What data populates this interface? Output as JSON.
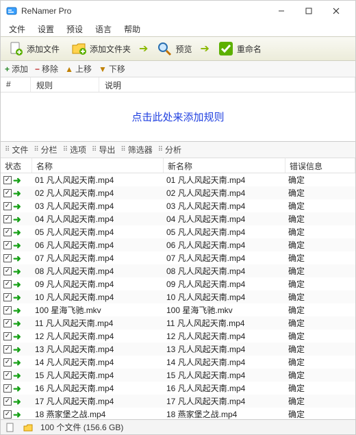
{
  "window": {
    "title": "ReNamer Pro"
  },
  "menu": {
    "file": "文件",
    "settings": "设置",
    "presets": "预设",
    "language": "语言",
    "help": "帮助"
  },
  "toolbar1": {
    "add_files": "添加文件",
    "add_folders": "添加文件夹",
    "preview": "预览",
    "rename": "重命名"
  },
  "toolbar2": {
    "add": "添加",
    "remove": "移除",
    "up": "上移",
    "down": "下移"
  },
  "rules": {
    "col_num": "#",
    "col_rule": "规则",
    "col_desc": "说明",
    "placeholder": "点击此处来添加规则"
  },
  "toolbar3": {
    "files": "文件",
    "columns": "分栏",
    "options": "选项",
    "export": "导出",
    "filter": "筛选器",
    "analyze": "分析"
  },
  "filecols": {
    "state": "状态",
    "name": "名称",
    "newname": "新名称",
    "err": "错误信息"
  },
  "files": [
    {
      "name": "01 凡人风起天南.mp4",
      "newname": "01 凡人风起天南.mp4",
      "err": "确定"
    },
    {
      "name": "02 凡人风起天南.mp4",
      "newname": "02 凡人风起天南.mp4",
      "err": "确定"
    },
    {
      "name": "03 凡人风起天南.mp4",
      "newname": "03 凡人风起天南.mp4",
      "err": "确定"
    },
    {
      "name": "04 凡人风起天南.mp4",
      "newname": "04 凡人风起天南.mp4",
      "err": "确定"
    },
    {
      "name": "05 凡人风起天南.mp4",
      "newname": "05 凡人风起天南.mp4",
      "err": "确定"
    },
    {
      "name": "06 凡人风起天南.mp4",
      "newname": "06 凡人风起天南.mp4",
      "err": "确定"
    },
    {
      "name": "07 凡人风起天南.mp4",
      "newname": "07 凡人风起天南.mp4",
      "err": "确定"
    },
    {
      "name": "08 凡人风起天南.mp4",
      "newname": "08 凡人风起天南.mp4",
      "err": "确定"
    },
    {
      "name": "09 凡人风起天南.mp4",
      "newname": "09 凡人风起天南.mp4",
      "err": "确定"
    },
    {
      "name": "10 凡人风起天南.mp4",
      "newname": "10 凡人风起天南.mp4",
      "err": "确定"
    },
    {
      "name": "100 星海飞驰.mkv",
      "newname": "100 星海飞驰.mkv",
      "err": "确定"
    },
    {
      "name": "11 凡人风起天南.mp4",
      "newname": "11 凡人风起天南.mp4",
      "err": "确定"
    },
    {
      "name": "12 凡人风起天南.mp4",
      "newname": "12 凡人风起天南.mp4",
      "err": "确定"
    },
    {
      "name": "13 凡人风起天南.mp4",
      "newname": "13 凡人风起天南.mp4",
      "err": "确定"
    },
    {
      "name": "14 凡人风起天南.mp4",
      "newname": "14 凡人风起天南.mp4",
      "err": "确定"
    },
    {
      "name": "15 凡人风起天南.mp4",
      "newname": "15 凡人风起天南.mp4",
      "err": "确定"
    },
    {
      "name": "16 凡人风起天南.mp4",
      "newname": "16 凡人风起天南.mp4",
      "err": "确定"
    },
    {
      "name": "17 凡人风起天南.mp4",
      "newname": "17 凡人风起天南.mp4",
      "err": "确定"
    },
    {
      "name": "18 燕家堡之战.mp4",
      "newname": "18 燕家堡之战.mp4",
      "err": "确定"
    }
  ],
  "status": {
    "count": "100 个文件 (156.6 GB)"
  }
}
